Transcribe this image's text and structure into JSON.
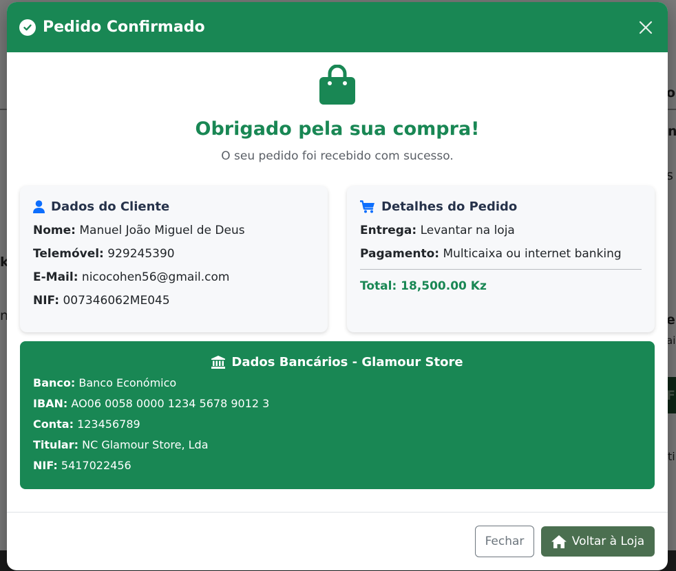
{
  "header": {
    "title": "Pedido Confirmado"
  },
  "hero": {
    "title": "Obrigado pela sua compra!",
    "subtitle": "O seu pedido foi recebido com sucesso."
  },
  "customer": {
    "title": "Dados do Cliente",
    "name_label": "Nome:",
    "name": "Manuel João Miguel de Deus",
    "phone_label": "Telemóvel:",
    "phone": "929245390",
    "email_label": "E-Mail:",
    "email": "nicocohen56@gmail.com",
    "nif_label": "NIF:",
    "nif": "007346062ME045"
  },
  "order": {
    "title": "Detalhes do Pedido",
    "delivery_label": "Entrega:",
    "delivery": "Levantar na loja",
    "payment_label": "Pagamento:",
    "payment": "Multicaixa ou internet banking",
    "total": "Total: 18,500.00 Kz"
  },
  "bank": {
    "title": "Dados Bancários - Glamour Store",
    "bank_label": "Banco:",
    "bank_name": "Banco Económico",
    "iban_label": "IBAN:",
    "iban": "AO06 0058 0000 1234 5678 9012 3",
    "account_label": "Conta:",
    "account": "123456789",
    "holder_label": "Titular:",
    "holder": "NC Glamour Store, Lda",
    "nif_label": "NIF:",
    "nif": "5417022456"
  },
  "footer": {
    "close_label": "Fechar",
    "home_label": "Voltar à Loja"
  },
  "background": {
    "fragment_1": "o",
    "fragment_2": "n",
    "fragment_3": "s",
    "fragment_4": "k",
    "fragment_5": "nc",
    "fragment_6": "e",
    "fragment_7": "ai",
    "fragment_8": "Fi",
    "fragment_9": "ti"
  },
  "colors": {
    "primary": "#198754",
    "header": "#198754",
    "home_button": "#4b6f50",
    "icon_blue": "#0d6efd"
  },
  "icons": {
    "header": "check-circle-icon",
    "close": "close-icon",
    "hero": "shopping-bag-icon",
    "customer": "user-icon",
    "order": "cart-icon",
    "bank": "bank-icon",
    "home": "home-icon"
  }
}
